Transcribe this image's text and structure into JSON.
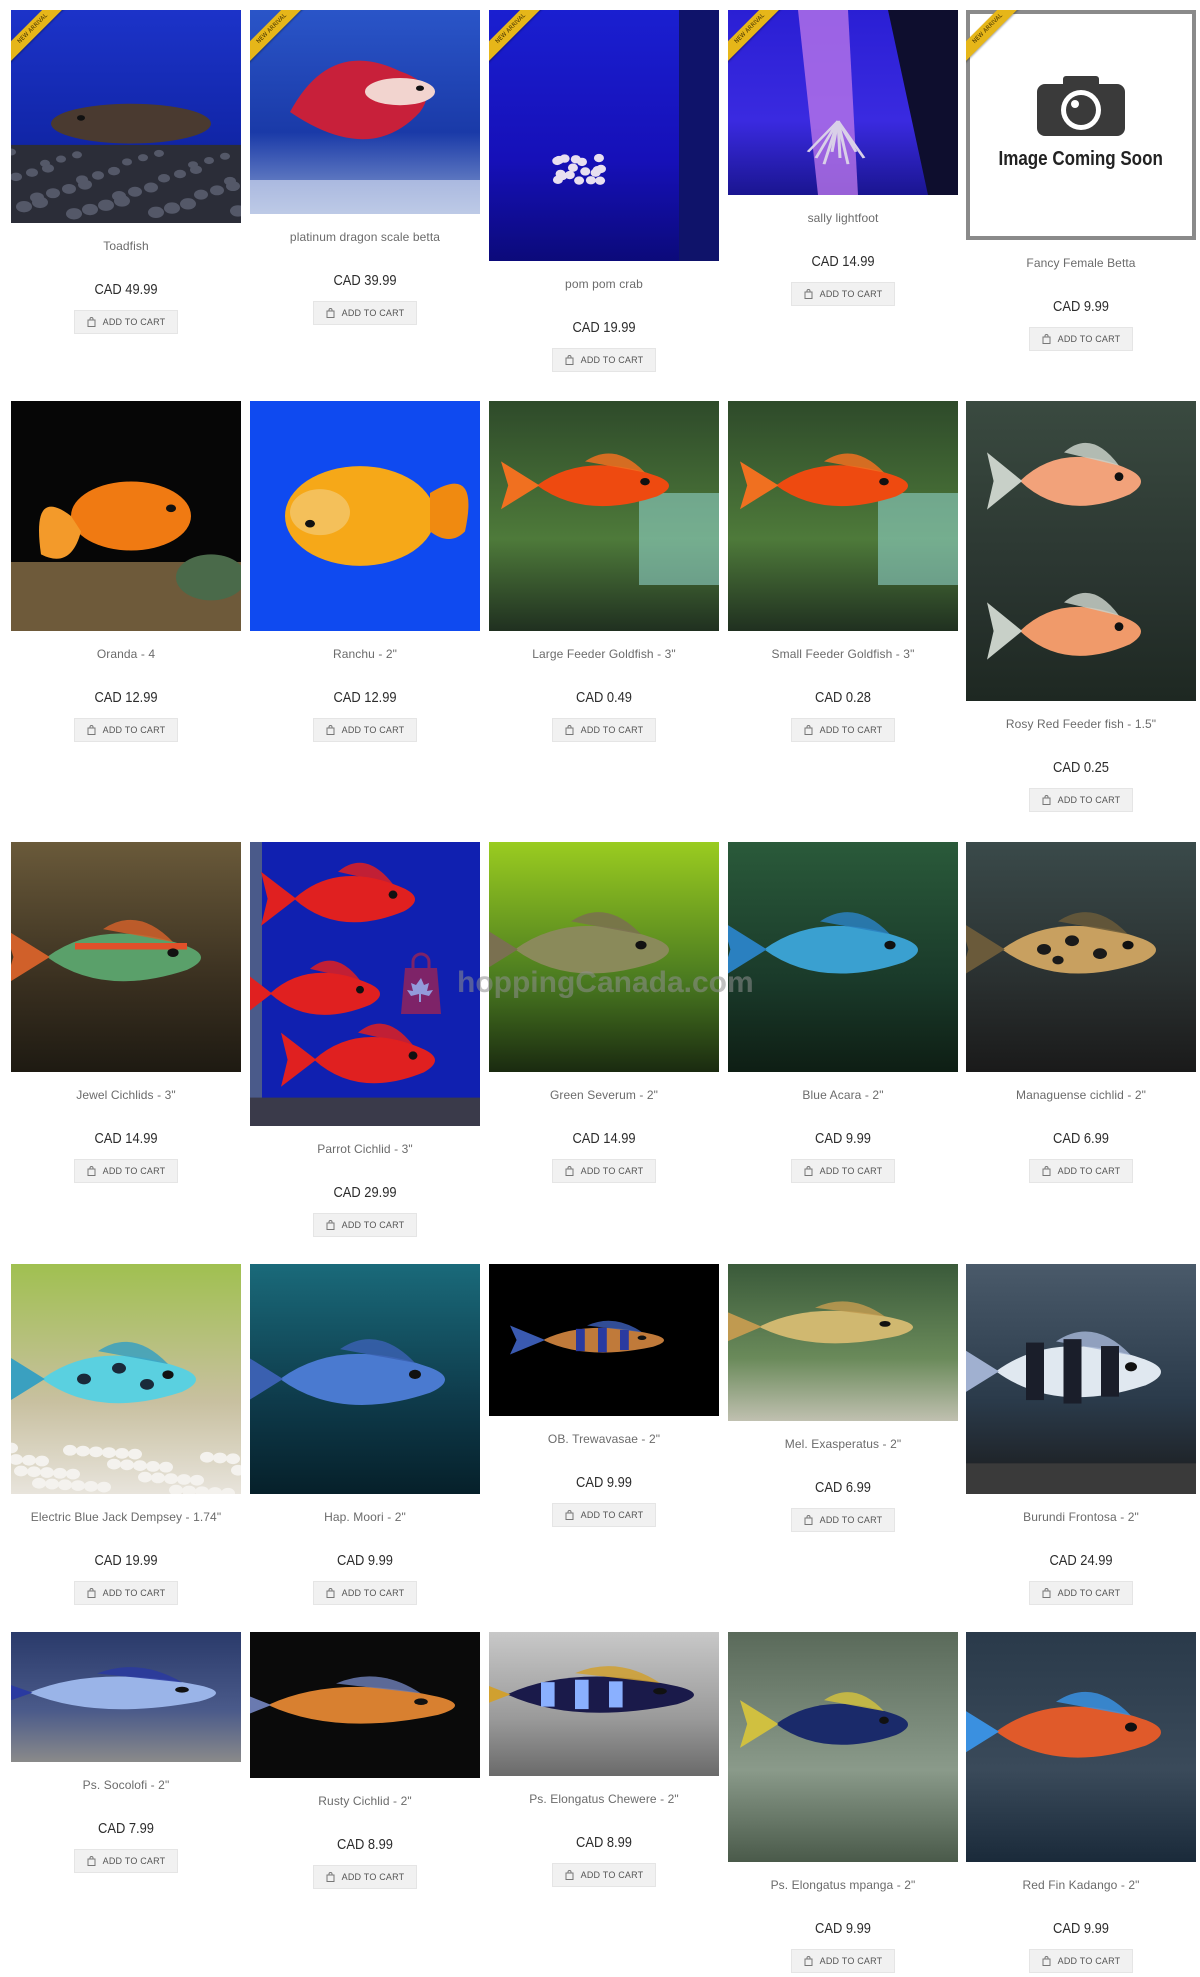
{
  "products": [
    {
      "name": "Toadfish",
      "price": "CAD 49.99",
      "art": "toadfish",
      "new": true
    },
    {
      "name": "platinum dragon scale betta",
      "price": "CAD 39.99",
      "art": "betta_red",
      "new": true
    },
    {
      "name": "pom pom crab",
      "price": "CAD 19.99",
      "art": "crab_blue",
      "new": true
    },
    {
      "name": "sally lightfoot",
      "price": "CAD 14.99",
      "art": "crab_tank",
      "new": true
    },
    {
      "name": "Fancy Female Betta",
      "price": "CAD 9.99",
      "art": "placeholder",
      "new": true
    },
    {
      "name": "Oranda - 4",
      "price": "CAD 12.99",
      "art": "goldfish_black"
    },
    {
      "name": "Ranchu - 2\"",
      "price": "CAD 12.99",
      "art": "goldfish_blue"
    },
    {
      "name": "Large Feeder Goldfish - 3\"",
      "price": "CAD 0.49",
      "art": "goldfish_green"
    },
    {
      "name": "Small Feeder Goldfish - 3\"",
      "price": "CAD 0.28",
      "art": "goldfish_green"
    },
    {
      "name": "Rosy Red Feeder fish - 1.5\"",
      "price": "CAD 0.25",
      "art": "rosy"
    },
    {
      "name": "Jewel Cichlids - 3\"",
      "price": "CAD 14.99",
      "art": "jewel"
    },
    {
      "name": "Parrot Cichlid - 3\"",
      "price": "CAD 29.99",
      "art": "parrot"
    },
    {
      "name": "Green Severum - 2\"",
      "price": "CAD 14.99",
      "art": "severum"
    },
    {
      "name": "Blue Acara - 2\"",
      "price": "CAD 9.99",
      "art": "acara"
    },
    {
      "name": "Managuense cichlid - 2\"",
      "price": "CAD 6.99",
      "art": "managuense"
    },
    {
      "name": "Electric Blue Jack Dempsey - 1.74\"",
      "price": "CAD 19.99",
      "art": "jackdempsey"
    },
    {
      "name": "Hap. Moori - 2\"",
      "price": "CAD 9.99",
      "art": "moori"
    },
    {
      "name": "OB. Trewavasae - 2\"",
      "price": "CAD 9.99",
      "art": "trewavasae"
    },
    {
      "name": "Mel. Exasperatus - 2\"",
      "price": "CAD 6.99",
      "art": "exasperatus"
    },
    {
      "name": "Burundi Frontosa - 2\"",
      "price": "CAD 24.99",
      "art": "frontosa"
    },
    {
      "name": "Ps. Socolofi - 2\"",
      "price": "CAD 7.99",
      "art": "socolofi"
    },
    {
      "name": "Rusty Cichlid - 2\"",
      "price": "CAD 8.99",
      "art": "rusty"
    },
    {
      "name": "Ps. Elongatus Chewere - 2\"",
      "price": "CAD 8.99",
      "art": "chewere"
    },
    {
      "name": "Ps. Elongatus mpanga - 2\"",
      "price": "CAD 9.99",
      "art": "mpanga"
    },
    {
      "name": "Red Fin Kadango - 2\"",
      "price": "CAD 9.99",
      "art": "kadango"
    }
  ],
  "labels": {
    "add_to_cart": "ADD TO CART",
    "new_arrival": "NEW ARRIVAL",
    "placeholder_text": "Image Coming Soon",
    "watermark": "hoppingCanada.com"
  },
  "colors": {
    "ribbon": "#e6b619",
    "button_bg": "#f1f1f1",
    "price_text": "#2c2c2c",
    "name_text": "#6b6b6b"
  },
  "icons": {
    "cart": "shopping-bag-icon",
    "watermark": "shopping-bag-maple-leaf-icon",
    "placeholder": "camera-icon"
  }
}
